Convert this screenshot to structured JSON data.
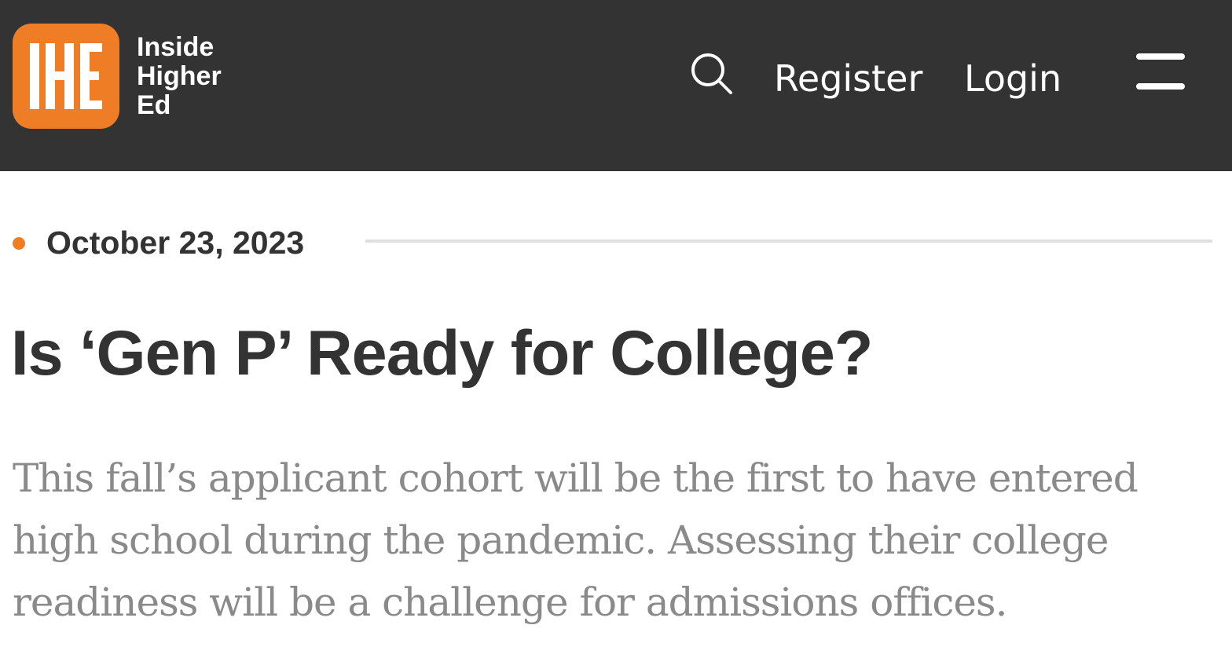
{
  "header": {
    "logo_monogram": "IHE",
    "logo_lines": [
      "Inside",
      "Higher",
      "Ed"
    ],
    "search_icon": "search-icon",
    "register_label": "Register",
    "login_label": "Login",
    "menu_icon": "hamburger-menu-icon",
    "colors": {
      "background": "#333333",
      "brand": "#ef7d25",
      "text": "#ffffff"
    }
  },
  "article": {
    "date": "October 23, 2023",
    "title": "Is ‘Gen P’ Ready for College?",
    "dek_lines": [
      "This fall’s applicant cohort will be the first to have entered",
      "high school during the pandemic. Assessing their college",
      "readiness will be a challenge for admissions offices."
    ],
    "colors": {
      "accent_dot": "#ef7d25",
      "title": "#333333",
      "dek": "#8a8a8a",
      "rule": "#e0e0e0"
    }
  }
}
